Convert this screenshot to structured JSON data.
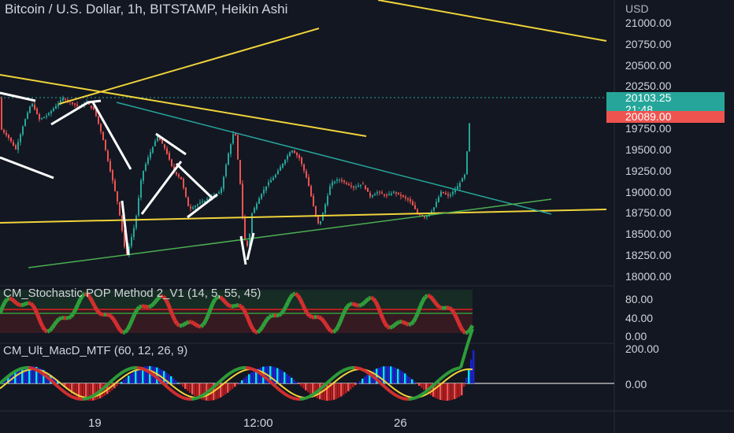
{
  "header": {
    "title": "Bitcoin / U.S. Dollar, 1h, BITSTAMP, Heikin Ashi",
    "currency": "USD"
  },
  "price_panel": {
    "last_price": "20103.25",
    "countdown": "21:48",
    "prev_price": "20089.00",
    "ticks": [
      "21000.00",
      "20750.00",
      "20500.00",
      "20250.00",
      "19750.00",
      "19500.00",
      "19250.00",
      "19000.00",
      "18750.00",
      "18500.00",
      "18250.00",
      "18000.00"
    ]
  },
  "stoch_panel": {
    "title": "CM_Stochastic POP Method 2_V1 (14, 5, 55, 45)",
    "ticks": [
      "80.00",
      "40.00",
      "0.00"
    ]
  },
  "macd_panel": {
    "title": "CM_Ult_MacD_MTF (60, 12, 26, 9)",
    "ticks": [
      "200.00",
      "0.00"
    ]
  },
  "x_axis": {
    "ticks": [
      "19",
      "12:00",
      "26"
    ]
  },
  "colors": {
    "background": "#131722",
    "up": "#26a69a",
    "down": "#ef5350",
    "trendline_yellow": "#f0d43a",
    "trendline_teal": "#26a69a",
    "trendline_green": "#4caf50",
    "pattern_white": "#ffffff"
  },
  "chart_data": [
    {
      "type": "candlestick",
      "series_name": "Heikin Ashi",
      "ylim": [
        17950,
        21300
      ],
      "x_ticks": [
        "19",
        "12:00",
        "26"
      ],
      "anchors": [
        [
          0,
          19800
        ],
        [
          10,
          19700
        ],
        [
          20,
          19550
        ],
        [
          30,
          19850
        ],
        [
          40,
          20100
        ],
        [
          50,
          19900
        ],
        [
          60,
          19950
        ],
        [
          70,
          20050
        ],
        [
          80,
          20150
        ],
        [
          90,
          20100
        ],
        [
          100,
          20050
        ],
        [
          110,
          20100
        ],
        [
          120,
          20000
        ],
        [
          130,
          19700
        ],
        [
          140,
          19300
        ],
        [
          150,
          18900
        ],
        [
          155,
          18600
        ],
        [
          160,
          18280
        ],
        [
          165,
          18450
        ],
        [
          172,
          18700
        ],
        [
          180,
          19250
        ],
        [
          190,
          19500
        ],
        [
          200,
          19700
        ],
        [
          210,
          19550
        ],
        [
          220,
          19300
        ],
        [
          230,
          19200
        ],
        [
          240,
          18850
        ],
        [
          250,
          18900
        ],
        [
          260,
          18950
        ],
        [
          270,
          19000
        ],
        [
          280,
          19050
        ],
        [
          290,
          19500
        ],
        [
          298,
          19800
        ],
        [
          305,
          19150
        ],
        [
          310,
          18500
        ],
        [
          315,
          18400
        ],
        [
          320,
          18800
        ],
        [
          330,
          19000
        ],
        [
          340,
          19150
        ],
        [
          350,
          19250
        ],
        [
          360,
          19400
        ],
        [
          370,
          19550
        ],
        [
          380,
          19450
        ],
        [
          390,
          19200
        ],
        [
          400,
          18800
        ],
        [
          405,
          18650
        ],
        [
          410,
          18800
        ],
        [
          420,
          19150
        ],
        [
          430,
          19200
        ],
        [
          440,
          19150
        ],
        [
          450,
          19100
        ],
        [
          460,
          19150
        ],
        [
          470,
          19000
        ],
        [
          480,
          19050
        ],
        [
          490,
          19000
        ],
        [
          500,
          19050
        ],
        [
          510,
          19000
        ],
        [
          520,
          18950
        ],
        [
          530,
          18800
        ],
        [
          540,
          18750
        ],
        [
          550,
          18850
        ],
        [
          560,
          19050
        ],
        [
          570,
          19000
        ],
        [
          580,
          19100
        ],
        [
          590,
          19250
        ],
        [
          595,
          19700
        ],
        [
          598,
          20150
        ]
      ]
    },
    {
      "type": "line",
      "title": "CM_Stochastic POP Method 2_V1 (14, 5, 55, 45)",
      "ylim": [
        0,
        100
      ]
    },
    {
      "type": "bar",
      "title": "CM_Ult_MacD_MTF (60, 12, 26, 9)",
      "ylim": [
        -120,
        220
      ]
    }
  ]
}
